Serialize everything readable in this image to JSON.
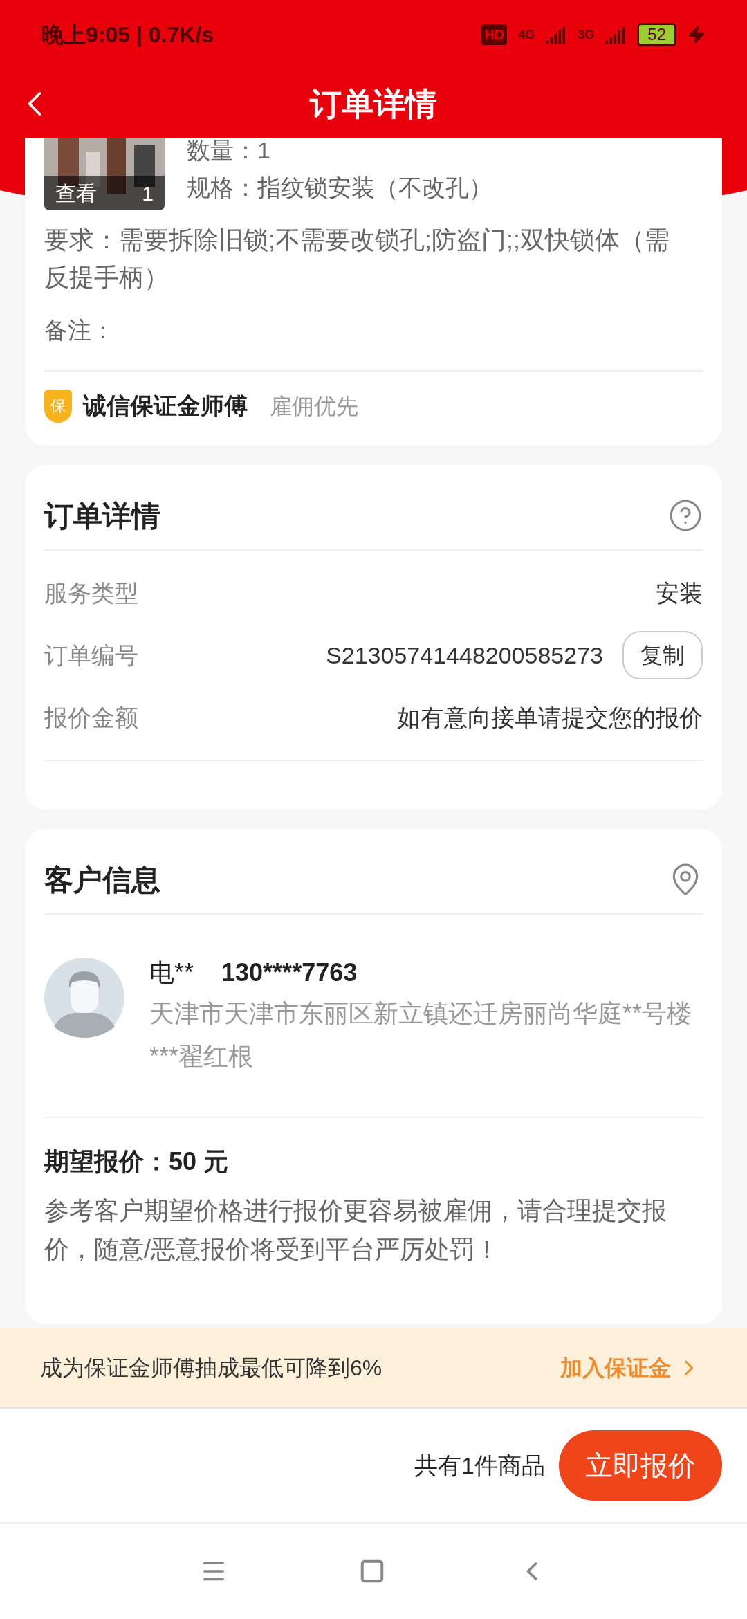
{
  "status_bar": {
    "time_speed": "晚上9:05 | 0.7K/s",
    "hd": "HD",
    "net1": "4G",
    "net2": "3G",
    "battery": "52"
  },
  "header": {
    "title": "订单详情"
  },
  "product": {
    "view_label": "查看",
    "count": "1",
    "quantity": "数量：1",
    "spec": "规格：指纹锁安装（不改孔）",
    "requirement": "要求：需要拆除旧锁;不需要改锁孔;防盗门;;双快锁体（需反提手柄）",
    "note": "备注：",
    "badge_char": "保",
    "badge_title": "诚信保证金师傅",
    "badge_sub": "雇佣优先"
  },
  "order": {
    "title": "订单详情",
    "rows": [
      {
        "kind": "text",
        "label": "服务类型",
        "value": "安装"
      },
      {
        "kind": "copy",
        "label": "订单编号",
        "value": "S21305741448200585273",
        "button": "复制"
      },
      {
        "kind": "text",
        "label": "报价金额",
        "value": "如有意向接单请提交您的报价"
      }
    ]
  },
  "customer": {
    "title": "客户信息",
    "name": "电**",
    "phone": "130****7763",
    "address": "天津市天津市东丽区新立镇还迁房丽尚华庭**号楼***翟红根",
    "expected": "期望报价：50 元",
    "notice": "参考客户期望价格进行报价更容易被雇佣，请合理提交报价，随意/恶意报价将受到平台严厉处罚！"
  },
  "banner": {
    "text": "成为保证金师傅抽成最低可降到6%",
    "link": "加入保证金"
  },
  "footer": {
    "summary": "共有1件商品",
    "button": "立即报价"
  }
}
